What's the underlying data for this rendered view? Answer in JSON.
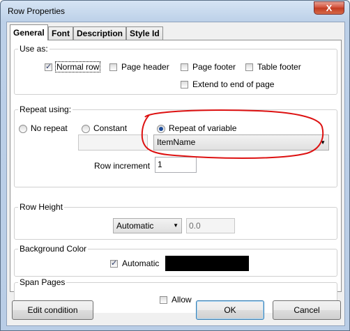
{
  "window": {
    "title": "Row Properties",
    "close_glyph": "X"
  },
  "tabs": [
    {
      "label": "General",
      "active": true
    },
    {
      "label": "Font",
      "active": false
    },
    {
      "label": "Description",
      "active": false
    },
    {
      "label": "Style Id",
      "active": false
    }
  ],
  "use_as": {
    "label": "Use as:",
    "normal_row": {
      "label": "Normal row",
      "checked": true
    },
    "page_header": {
      "label": "Page header",
      "checked": false
    },
    "page_footer": {
      "label": "Page footer",
      "checked": false
    },
    "table_footer": {
      "label": "Table footer",
      "checked": false
    },
    "extend": {
      "label": "Extend to end of page",
      "checked": false
    }
  },
  "repeat": {
    "label": "Repeat using:",
    "no_repeat": {
      "label": "No repeat",
      "selected": false
    },
    "constant": {
      "label": "Constant",
      "selected": false
    },
    "repeat_of_variable": {
      "label": "Repeat of variable",
      "selected": true
    },
    "constant_value": "",
    "variable_value": "ItemName",
    "row_increment_label": "Row increment",
    "row_increment_value": "1"
  },
  "row_height": {
    "label": "Row Height",
    "mode": "Automatic",
    "value": "0.0"
  },
  "background": {
    "label": "Background Color",
    "automatic": {
      "label": "Automatic",
      "checked": true
    },
    "color": "#000000"
  },
  "span_pages": {
    "label": "Span Pages",
    "allow": {
      "label": "Allow",
      "checked": false
    }
  },
  "buttons": {
    "edit_condition": "Edit condition",
    "ok": "OK",
    "cancel": "Cancel"
  },
  "colors": {
    "annotation": "#dd1111",
    "radio_fill": "#1c4c9a"
  }
}
